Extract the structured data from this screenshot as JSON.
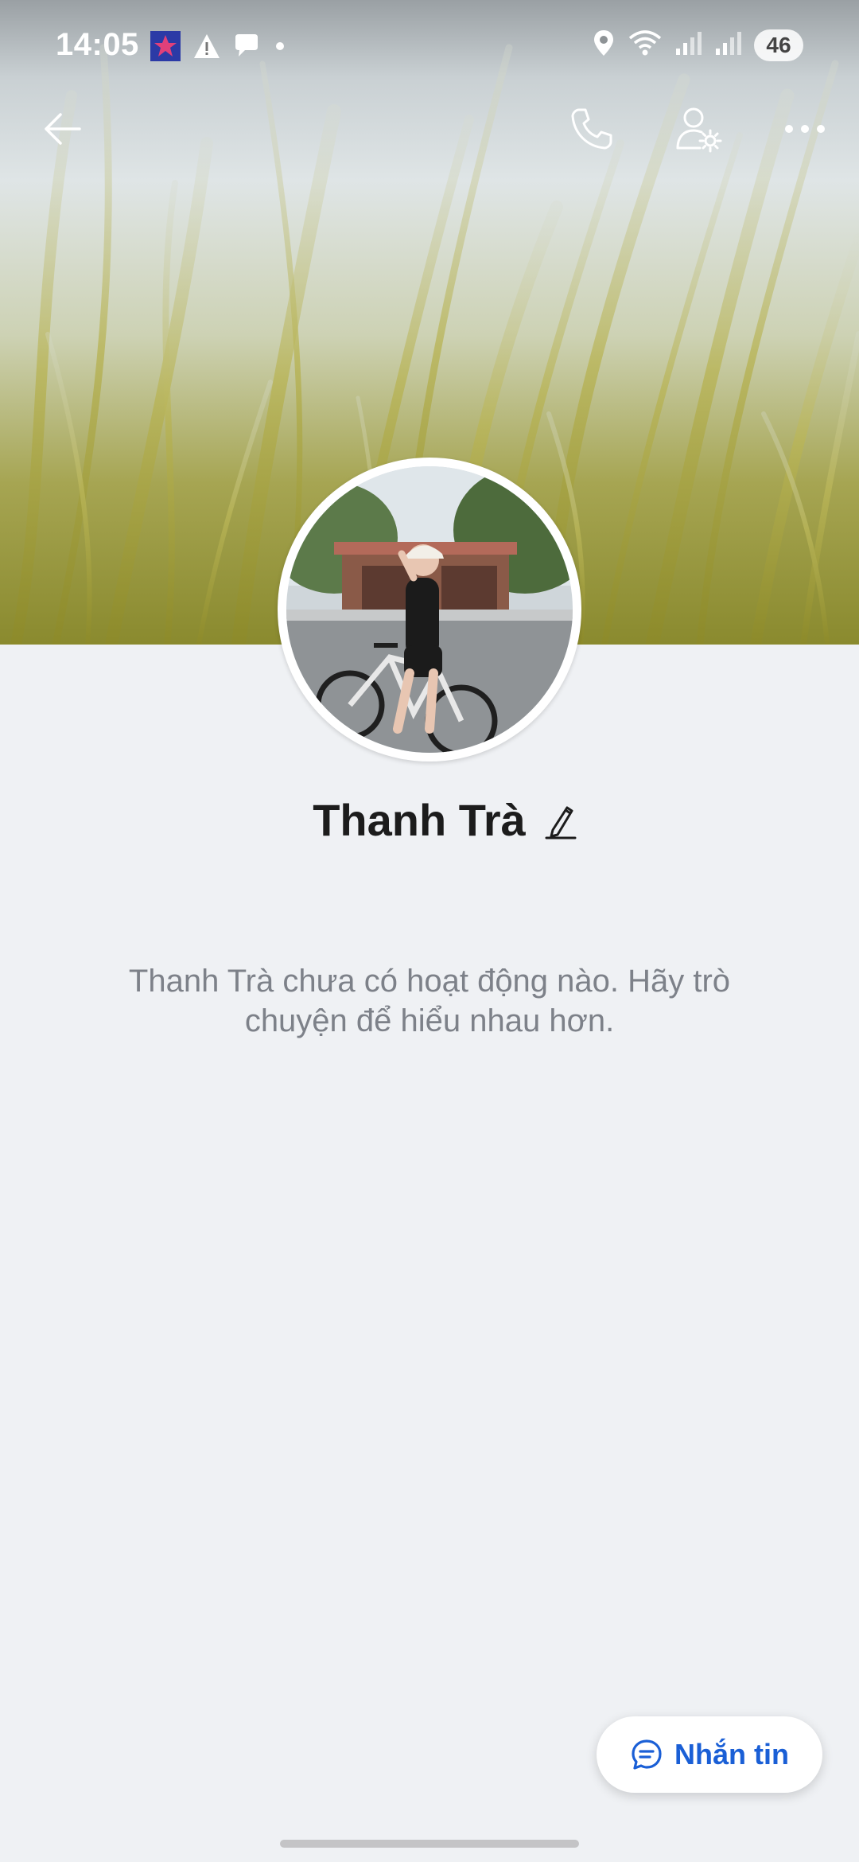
{
  "status_bar": {
    "time": "14:05",
    "battery": "46",
    "icons_left": [
      "app-notification-icon",
      "warning-icon",
      "chat-bubble-icon",
      "dot-icon"
    ],
    "icons_right": [
      "location-icon",
      "wifi-icon",
      "signal-icon",
      "signal-icon"
    ]
  },
  "topbar": {
    "icons": [
      "back-arrow-icon",
      "phone-icon",
      "profile-settings-icon",
      "more-icon"
    ]
  },
  "profile": {
    "name": "Thanh Trà",
    "empty_activity": "Thanh Trà chưa có hoạt động nào. Hãy trò chuyện để hiểu nhau hơn."
  },
  "actions": {
    "message_label": "Nhắn tin"
  },
  "colors": {
    "background": "#eff1f4",
    "accent": "#1a5fd6",
    "name_text": "#1c1c1c",
    "secondary_text": "#7d8189"
  }
}
